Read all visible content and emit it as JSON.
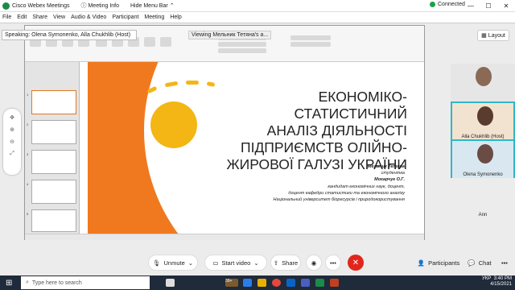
{
  "titlebar": {
    "app": "Cisco Webex Meetings",
    "meeting_info": "Meeting Info",
    "hide_menu": "Hide Menu Bar",
    "status": "Connected"
  },
  "menu": [
    "File",
    "Edit",
    "Share",
    "View",
    "Audio & Video",
    "Participant",
    "Meeting",
    "Help"
  ],
  "speaking": "Speaking: Olena Symonenko, Alla Chukhlib (Host)",
  "viewing": "Viewing Мельник Тетяна's a...",
  "layout_label": "Layout",
  "slide": {
    "title": [
      "ЕКОНОМІКО-СТАТИСТИЧНИЙ",
      "АНАЛІЗ ДІЯЛЬНОСТІ",
      "ПІДПРИЄМСТВ ОЛІЙНО-",
      "ЖИРОВОЇ ГАЛУЗІ УКРАЇНИ"
    ],
    "author": "Мельник Тетяна",
    "role": "студентка",
    "supervisor": "Мохарчук О.Г.",
    "supervisor_title": "кандидат економічних наук, доцент,",
    "department": "доцент кафедри статистики та економічного аналізу",
    "university": "Національний університет біоресурсів і природокористування"
  },
  "participants": [
    {
      "name": "",
      "label": ""
    },
    {
      "name": "Alla Chukhlib",
      "label": "(Host)"
    },
    {
      "name": "Olena Symonenko",
      "label": ""
    },
    {
      "name": "Ann",
      "label": ""
    }
  ],
  "controls": {
    "mute": "Unmute",
    "video": "Start video",
    "share": "Share",
    "participants": "Participants",
    "chat": "Chat"
  },
  "taskbar": {
    "search_placeholder": "Type here to search",
    "time": "3:40 PM",
    "date": "4/15/2021",
    "lang": "УКР",
    "weather": "39+",
    "notif": "22"
  }
}
